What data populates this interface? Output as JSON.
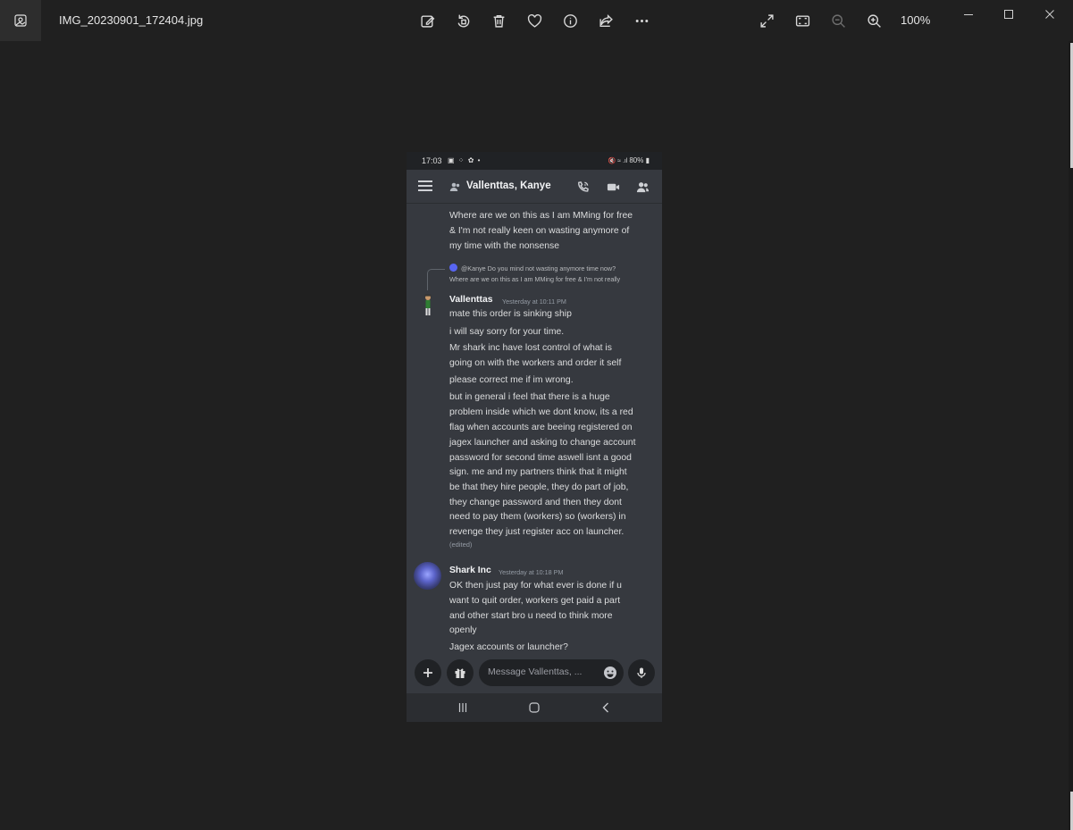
{
  "viewer": {
    "filename": "IMG_20230901_172404.jpg",
    "zoom": "100%",
    "toolbar_icons": [
      "edit-icon",
      "rotate-icon",
      "delete-icon",
      "favorite-icon",
      "info-icon",
      "share-icon",
      "more-icon",
      "fullscreen-icon",
      "fit-icon",
      "zoom-out-icon",
      "zoom-in-icon"
    ]
  },
  "phone": {
    "status": {
      "time": "17:03",
      "right": "80%"
    },
    "header": {
      "title": "Vallenttas, Kanye"
    },
    "messages": {
      "prev_lines": [
        "Where are we on this as I am MMing for free",
        "& I'm not really keen on wasting anymore of",
        "my time with the nonsense"
      ],
      "reply": {
        "line1": "@Kanye Do you mind not wasting anymore time now?",
        "line2": "Where are we on this as I am MMing for free & I'm not really"
      },
      "vallenttas": {
        "author": "Vallenttas",
        "timestamp": "Yesterday at 10:11 PM",
        "lines": [
          "mate this order is sinking ship",
          "i will say sorry for your time.",
          "Mr shark inc have lost control of what is",
          "going on with the workers and order it self",
          "please correct me if im wrong.",
          "but in general i feel that there is a huge",
          "problem inside which we dont know, its a red",
          "flag when accounts are beeing registered on",
          "jagex launcher and asking to change account",
          "password for second time aswell isnt a good",
          "sign. me and my partners think that it might",
          "be that they hire people, they do part of job,",
          "they change password and then they dont",
          "need to pay them (workers)  so (workers) in",
          "revenge they just register acc on launcher."
        ],
        "edited": "(edited)"
      },
      "shark": {
        "author": "Shark Inc",
        "timestamp": "Yesterday at 10:18 PM",
        "lines": [
          "OK then just pay for what ever is done if u",
          "want to quit order, workers get paid a part",
          "and other start bro u need to think more",
          "openly",
          "Jagex accounts or launcher?"
        ]
      }
    },
    "composer": {
      "placeholder": "Message Vallenttas, ..."
    }
  }
}
